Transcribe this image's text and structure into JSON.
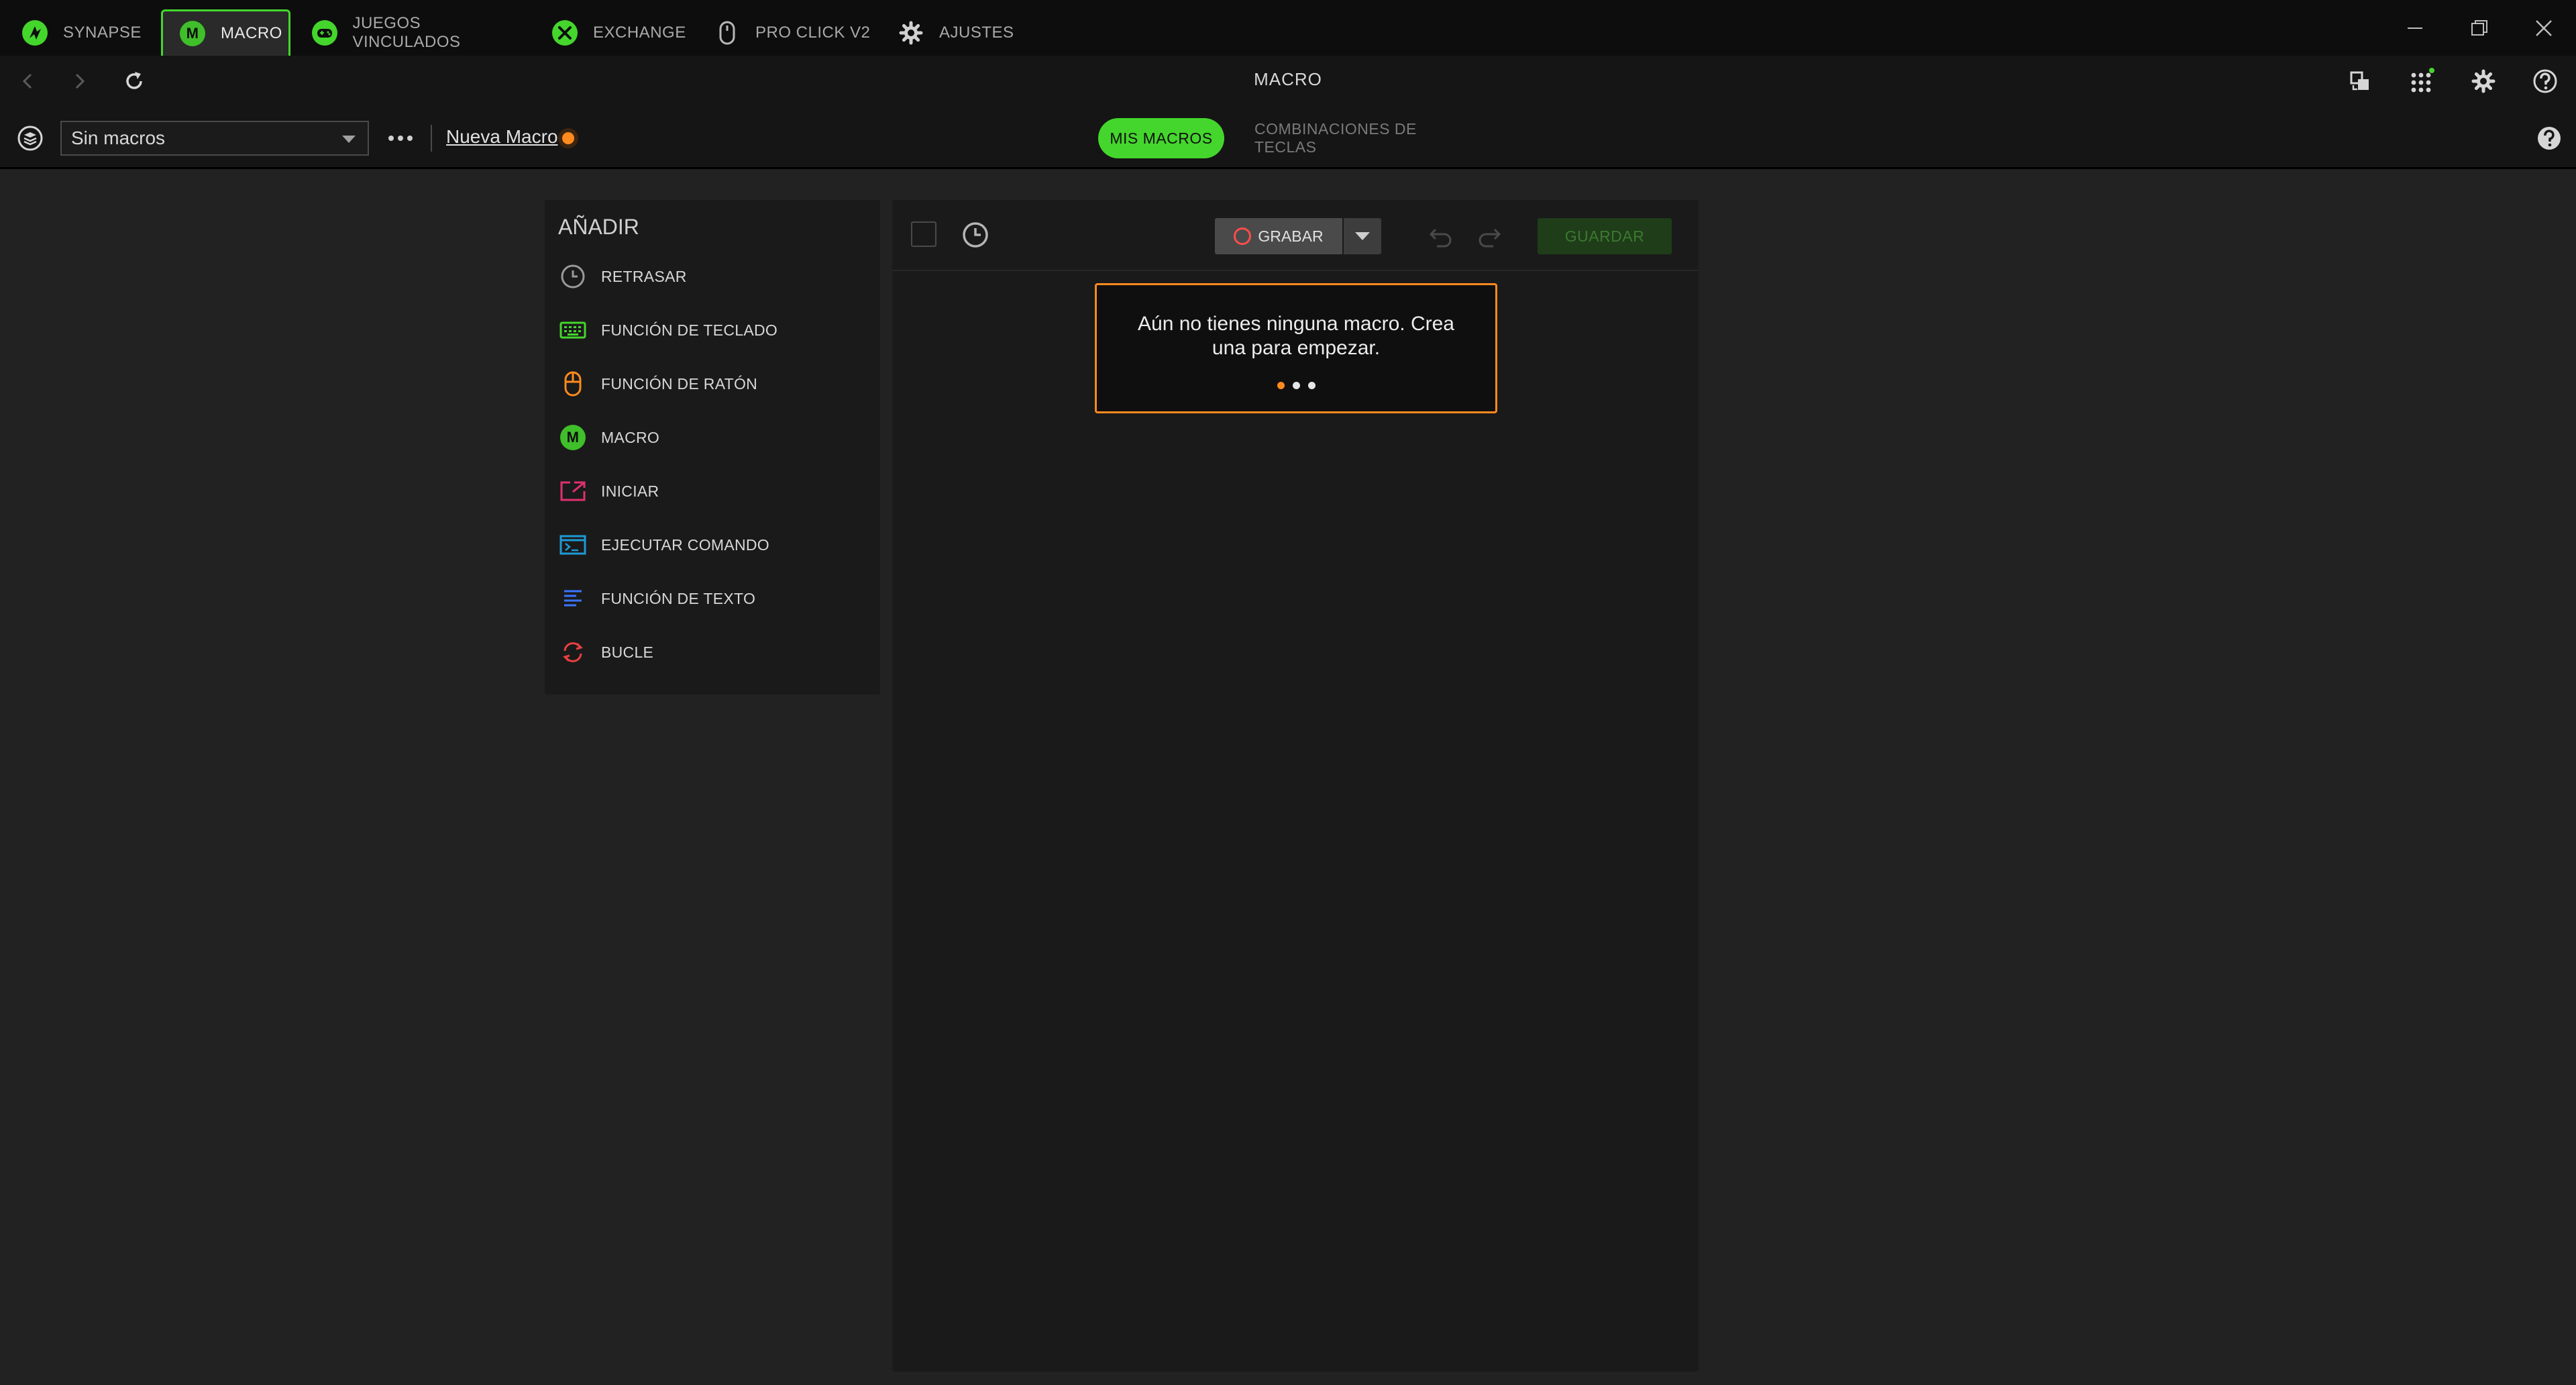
{
  "tabs": [
    {
      "label": "SYNAPSE",
      "icon": "razer-logo-icon",
      "active": false
    },
    {
      "label": "MACRO",
      "icon": "macro-m-icon",
      "active": true
    },
    {
      "label": "JUEGOS VINCULADOS",
      "icon": "gamepad-icon",
      "active": false
    },
    {
      "label": "EXCHANGE",
      "icon": "exchange-icon",
      "active": false
    },
    {
      "label": "PRO CLICK V2",
      "icon": "mouse-icon",
      "active": false
    },
    {
      "label": "AJUSTES",
      "icon": "gear-icon",
      "active": false
    }
  ],
  "tab_badge": "M",
  "window_controls": [
    "minimize-icon",
    "restore-icon",
    "close-icon"
  ],
  "nav": {
    "title": "MACRO",
    "left_icons": [
      "back-arrow-icon",
      "forward-arrow-icon",
      "refresh-icon"
    ],
    "right_icons": [
      "device-swap-icon",
      "apps-grid-icon",
      "settings-icon",
      "help-circle-icon"
    ],
    "notification_color": "#44d62c"
  },
  "toolbar": {
    "macro_select_value": "Sin macros",
    "new_macro_label": "Nueva Macro",
    "tab_my_macros": "MIS MACROS",
    "tab_key_combos": "COMBINACIONES DE TECLAS",
    "help_icon": "help-icon"
  },
  "add_panel": {
    "title": "AÑADIR",
    "items": [
      {
        "label": "RETRASAR",
        "icon": "clock-icon",
        "color": "#9a9a9a"
      },
      {
        "label": "FUNCIÓN DE TECLADO",
        "icon": "keyboard-icon",
        "color": "#44d62c"
      },
      {
        "label": "FUNCIÓN DE RATÓN",
        "icon": "mouse-icon",
        "color": "#ff8a1e"
      },
      {
        "label": "MACRO",
        "icon": "macro-m-icon",
        "color": "#44d62c"
      },
      {
        "label": "INICIAR",
        "icon": "launch-icon",
        "color": "#e0306f"
      },
      {
        "label": "EJECUTAR COMANDO",
        "icon": "terminal-icon",
        "color": "#1e9ad6"
      },
      {
        "label": "FUNCIÓN DE TEXTO",
        "icon": "text-lines-icon",
        "color": "#3c74ff"
      },
      {
        "label": "BUCLE",
        "icon": "loop-icon",
        "color": "#e84040"
      }
    ],
    "macro_badge": "M"
  },
  "editor": {
    "record_label": "GRABAR",
    "save_label": "GUARDAR"
  },
  "tooltip": {
    "text": "Aún no tienes ninguna macro. Crea una para empezar.",
    "step_count": 3,
    "active_step": 1
  },
  "colors": {
    "accent": "#44d62c",
    "highlight": "#ff8a1e",
    "record": "#ff4d4d"
  }
}
